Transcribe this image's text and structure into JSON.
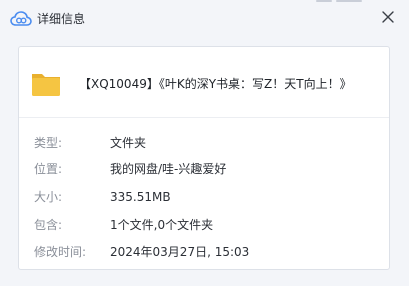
{
  "window": {
    "title": "详细信息"
  },
  "file": {
    "name": "【XQ10049】《叶K的深Y书桌：写Z！天T向上！》",
    "icon": "folder-icon"
  },
  "details": [
    {
      "label": "类型:",
      "value": "文件夹"
    },
    {
      "label": "位置:",
      "value": "我的网盘/哇-兴趣爱好"
    },
    {
      "label": "大小:",
      "value": "335.51MB"
    },
    {
      "label": "包含:",
      "value": "1个文件,0个文件夹"
    },
    {
      "label": "修改时间:",
      "value": "2024年03月27日, 15:03"
    }
  ],
  "colors": {
    "folder": "#f5c542",
    "folder_tab": "#e9b02e",
    "cloud": "#4a8cf0"
  }
}
